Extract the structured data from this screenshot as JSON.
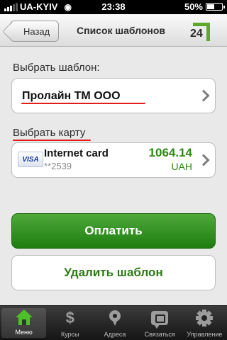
{
  "status_bar": {
    "carrier": "UA-KYIV",
    "time": "23:38",
    "battery_percent": "50%",
    "battery_level": 0.5
  },
  "nav": {
    "back_label": "Назад",
    "title": "Список шаблонов",
    "logo_text": "24"
  },
  "template": {
    "label": "Выбрать шаблон:",
    "value": "Пролайн ТМ ООО"
  },
  "card": {
    "label": "Выбрать карту",
    "brand": "VISA",
    "name": "Internet card",
    "number": "**2539",
    "amount": "1064.14",
    "currency": "UAH"
  },
  "buttons": {
    "pay": "Оплатить",
    "delete": "Удалить шаблон"
  },
  "tabs": [
    {
      "label": "Меню",
      "icon": "home-icon",
      "active": true
    },
    {
      "label": "Курсы",
      "icon": "dollar-icon",
      "active": false
    },
    {
      "label": "Адреса",
      "icon": "map-pin-icon",
      "active": false
    },
    {
      "label": "Связаться",
      "icon": "chat-icon",
      "active": false
    },
    {
      "label": "Управление",
      "icon": "gear-icon",
      "active": false
    }
  ],
  "colors": {
    "accent_green": "#2d8a12",
    "annotation_red": "#e21b1b",
    "logo_green": "#5ea82a"
  }
}
